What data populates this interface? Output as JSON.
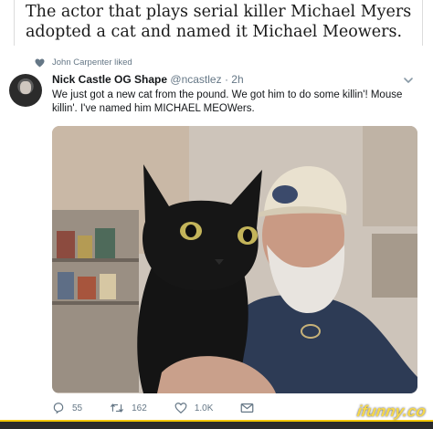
{
  "caption": {
    "text": "The actor that plays serial killer Michael Myers adopted a cat and named it Michael Meowers."
  },
  "tweet": {
    "liked_by": "John Carpenter liked",
    "display_name": "Nick Castle OG Shape",
    "handle": "@ncastlez",
    "separator": "·",
    "time": "2h",
    "text": "We just got a new cat from the pound.  We got him to do some killin'! Mouse killin'.  I've named him MICHAEL MEOWers.",
    "actions": {
      "reply_count": "55",
      "retweet_count": "162",
      "like_count": "1.0K"
    },
    "icons": [
      "heart-small-icon",
      "chevron-down-icon",
      "reply-icon",
      "retweet-icon",
      "like-icon",
      "message-icon"
    ]
  },
  "watermark": "ifunny.co",
  "colors": {
    "text_primary": "#14171a",
    "text_secondary": "#657786",
    "footer": "#2b2b2b",
    "watermark": "#f6d84b"
  }
}
